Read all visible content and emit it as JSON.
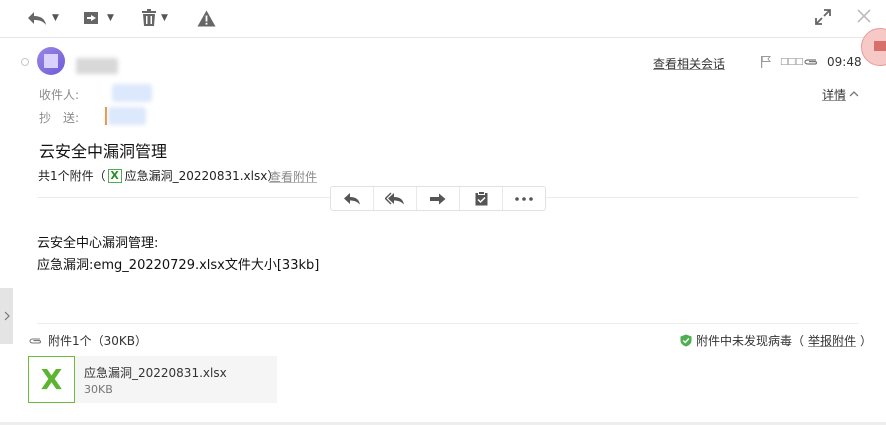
{
  "toolbar": {
    "reply_icon": "reply-all-icon",
    "move_icon": "move-to-folder-icon",
    "delete_icon": "trash-icon",
    "spam_icon": "warning-icon",
    "expand_icon": "expand-icon",
    "close_icon": "close-icon"
  },
  "header": {
    "related_link": "查看相关会话",
    "time": "09:48",
    "recipients_label": "收件人:",
    "cc_label": "抄　送:",
    "details_link": "详情",
    "details_caret": "^"
  },
  "subject": "云安全中漏洞管理",
  "attachment_summary": {
    "prefix": "共1个附件（",
    "filename": "应急漏洞_20220831.xlsx",
    "suffix": "）",
    "view_link": "查看附件"
  },
  "action_bar": [
    "reply-icon",
    "reply-all-icon",
    "forward-icon",
    "clipboard-icon",
    "more-icon"
  ],
  "body": {
    "line1": "云安全中心漏洞管理:",
    "line2": "应急漏洞:emg_20220729.xlsx文件大小[33kb]"
  },
  "attachments": {
    "count_label": "附件1个（30KB）",
    "virus_text": "附件中未发现病毒（",
    "report_link": "举报附件",
    "virus_close": "）",
    "file": {
      "name": "应急漏洞_20220831.xlsx",
      "size": "30KB",
      "icon_letter": "X"
    }
  },
  "colors": {
    "accent_green": "#5cb531",
    "cc_marker": "#f08c2f",
    "avatar": "#7a66dc"
  }
}
